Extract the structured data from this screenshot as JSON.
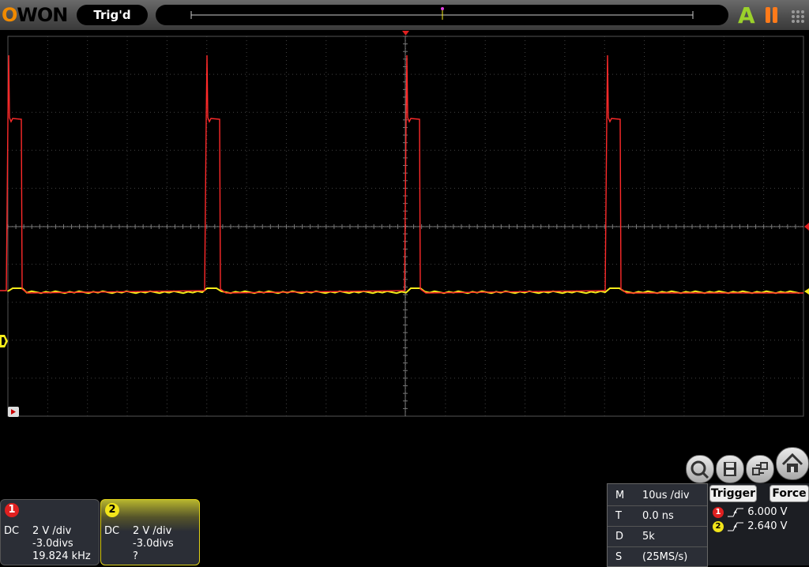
{
  "header": {
    "logo": "OWON",
    "status": "Trig'd",
    "mode_badge": "A"
  },
  "colors": {
    "ch1": "#ff2a2a",
    "ch2": "#f5ec1a",
    "accent": "#f08a00"
  },
  "icons": [
    "search-zoom-icon",
    "save-icon",
    "swap-icon",
    "home-icon",
    "pause-icon",
    "trigger-marker-icon"
  ],
  "channels": [
    {
      "number": "1",
      "coupling": "DC",
      "scale": "2 V /div",
      "offset": "-3.0divs",
      "measurement": "19.824 kHz"
    },
    {
      "number": "2",
      "coupling": "DC",
      "scale": "2 V /div",
      "offset": "-3.0divs",
      "measurement": "?"
    }
  ],
  "timebase": {
    "rows": [
      {
        "key": "M",
        "value": "10us /div"
      },
      {
        "key": "T",
        "value": "0.0 ns"
      },
      {
        "key": "D",
        "value": "5k"
      },
      {
        "key": "S",
        "value": "(25MS/s)"
      }
    ]
  },
  "trigger": {
    "trigger_label": "Trigger",
    "force_label": "Force",
    "levels": [
      {
        "channel": "1",
        "value": "6.000 V"
      },
      {
        "channel": "2",
        "value": "2.640 V"
      }
    ]
  }
}
